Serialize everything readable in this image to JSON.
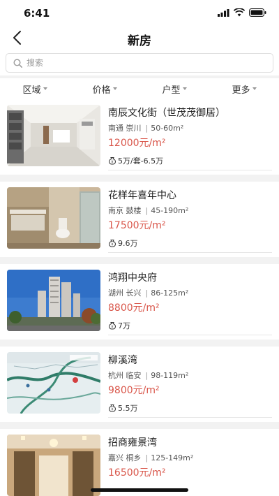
{
  "status_bar": {
    "time": "6:41"
  },
  "nav": {
    "title": "新房"
  },
  "search": {
    "placeholder": "搜索"
  },
  "filters": [
    {
      "label": "区域"
    },
    {
      "label": "价格"
    },
    {
      "label": "户型"
    },
    {
      "label": "更多"
    }
  ],
  "listings": [
    {
      "name": "南辰文化街（世茂茂御居）",
      "city": "南通",
      "district": "崇川",
      "area": "50-60m²",
      "price": "12000元/m²",
      "total": "5万/套-6.5万",
      "image": "interior-hall"
    },
    {
      "name": "花样年喜年中心",
      "city": "南京",
      "district": "鼓楼",
      "area": "45-190m²",
      "price": "17500元/m²",
      "total": "9.6万",
      "image": "bathroom"
    },
    {
      "name": "鸿翔中央府",
      "city": "湖州",
      "district": "长兴",
      "area": "86-125m²",
      "price": "8800元/m²",
      "total": "7万",
      "image": "towers"
    },
    {
      "name": "柳溪湾",
      "city": "杭州",
      "district": "临安",
      "area": "98-119m²",
      "price": "9800元/m²",
      "total": "5.5万",
      "image": "map"
    },
    {
      "name": "招商雍景湾",
      "city": "嘉兴",
      "district": "桐乡",
      "area": "125-149m²",
      "price": "16500元/m²",
      "total": "",
      "image": "lobby"
    }
  ],
  "colors": {
    "price": "#d9564a",
    "background": "#f2f2f2"
  }
}
